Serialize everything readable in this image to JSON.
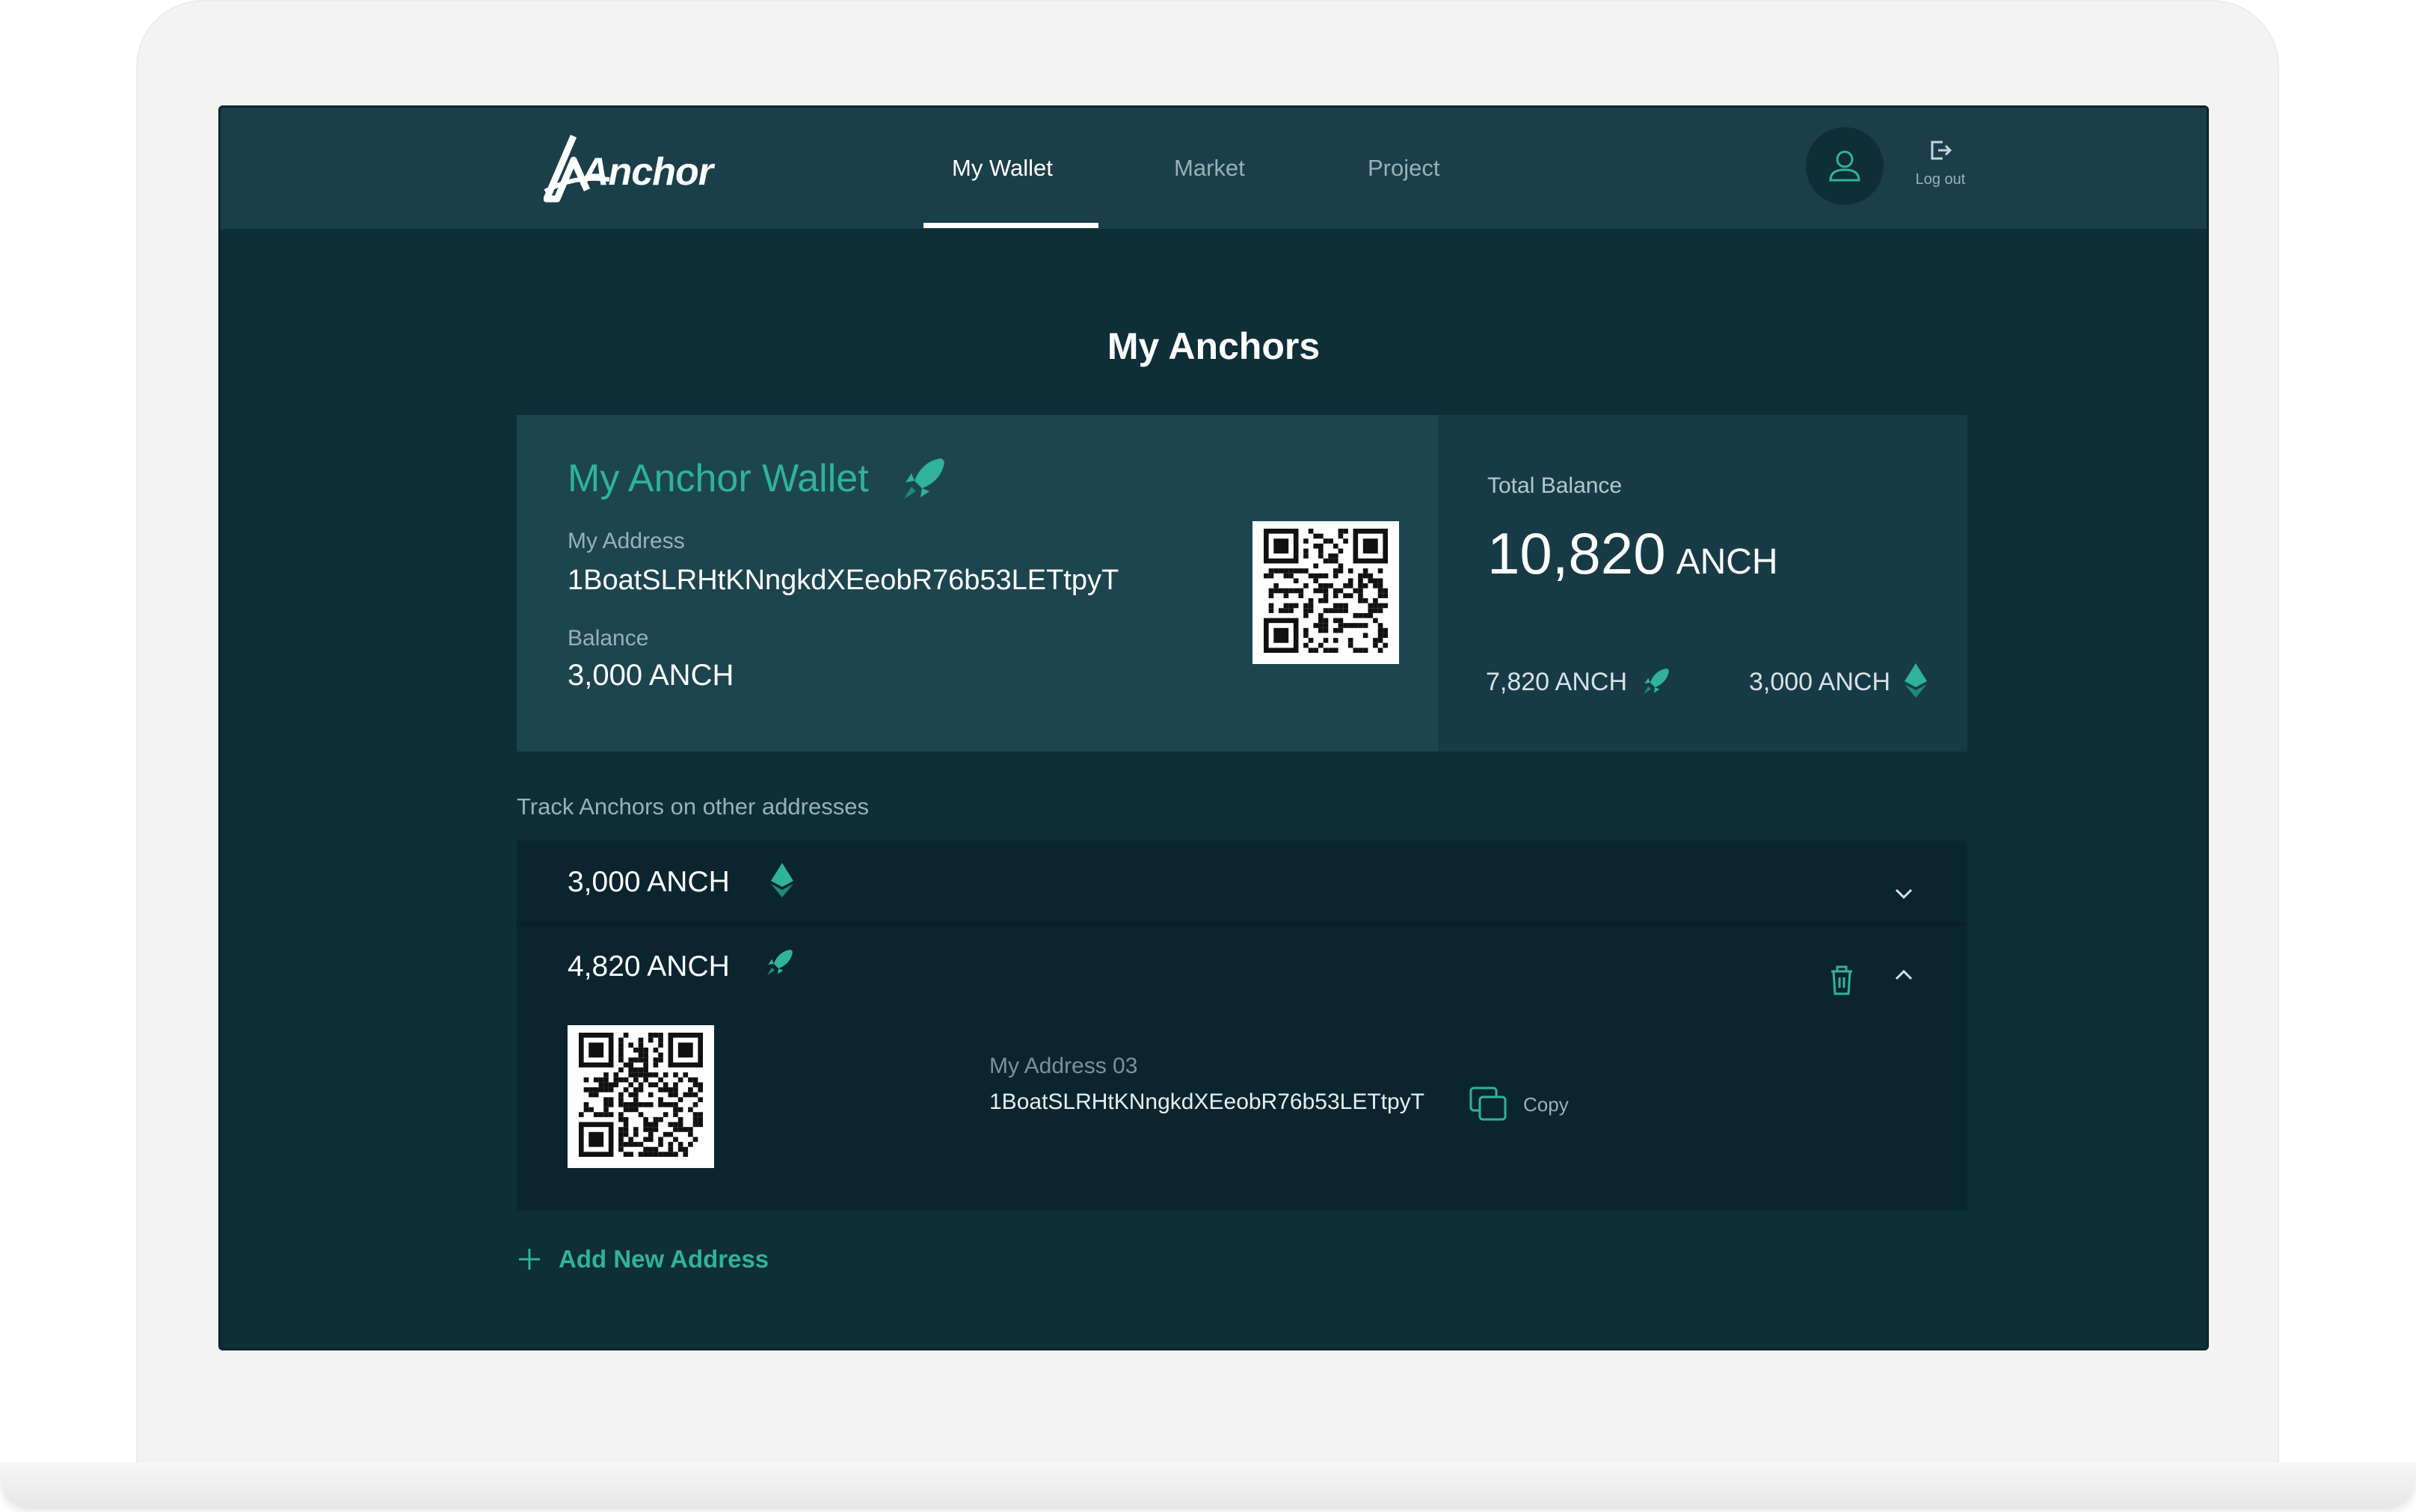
{
  "header": {
    "logo_text": "Anchor",
    "nav": [
      {
        "label": "My Wallet",
        "active": true
      },
      {
        "label": "Market",
        "active": false
      },
      {
        "label": "Project",
        "active": false
      }
    ],
    "logout_label": "Log out",
    "icons": {
      "profile": "user-icon",
      "logout": "logout-icon"
    }
  },
  "page": {
    "title": "My Anchors"
  },
  "wallet": {
    "title": "My Anchor Wallet",
    "address_label": "My Address",
    "address": "1BoatSLRHtKNngkdXEeobR76b53LETtpyT",
    "balance_label": "Balance",
    "balance": "3,000 ANCH"
  },
  "total": {
    "label": "Total Balance",
    "value": "10,820",
    "unit": "ANCH",
    "breakdown": [
      {
        "amount": "7,820 ANCH",
        "icon": "rocket-icon"
      },
      {
        "amount": "3,000 ANCH",
        "icon": "ethereum-icon"
      }
    ]
  },
  "tracked": {
    "label": "Track Anchors on other addresses",
    "items": [
      {
        "amount": "3,000 ANCH",
        "icon": "ethereum-icon",
        "expanded": false
      },
      {
        "amount": "4,820 ANCH",
        "icon": "rocket-icon",
        "expanded": true,
        "address_label": "My Address 03",
        "address": "1BoatSLRHtKNngkdXEeobR76b53LETtpyT",
        "copy_label": "Copy"
      }
    ],
    "add_label": "Add New Address"
  },
  "colors": {
    "accent": "#2fb39a",
    "background": "#0e2e38",
    "card": "#1d4550",
    "header": "#1a3f4a"
  }
}
